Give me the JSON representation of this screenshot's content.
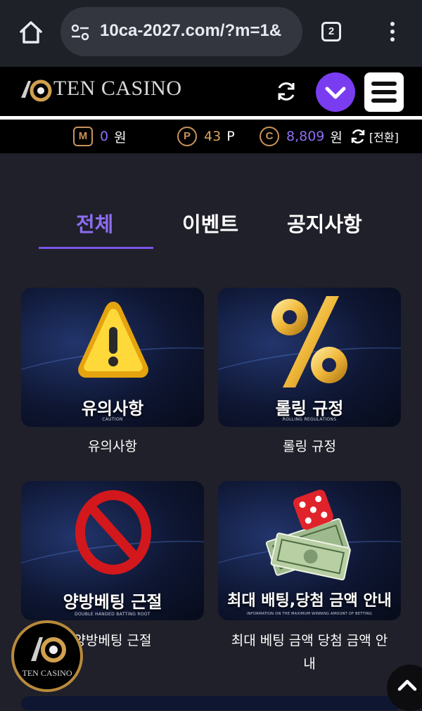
{
  "browser": {
    "url": "10ca-2027.com/?m=1&",
    "tab_count": "2"
  },
  "header": {
    "logo_text": "TEN CASINO"
  },
  "balance": {
    "money_badge": "M",
    "money_value": "0",
    "money_unit": "원",
    "point_badge": "P",
    "point_value": "43",
    "point_unit": "P",
    "coin_badge": "C",
    "coin_value": "8,809",
    "coin_unit": "원",
    "exchange_label": "[전환]"
  },
  "tabs": [
    {
      "label": "전체",
      "active": true
    },
    {
      "label": "이벤트",
      "active": false
    },
    {
      "label": "공지사항",
      "active": false
    }
  ],
  "cards": [
    {
      "title": "유의사항",
      "subtitle": "CAUTION",
      "caption": "유의사항",
      "icon": "warning-icon"
    },
    {
      "title": "롤링 규정",
      "subtitle": "ROLLING REGULATIONS",
      "caption": "롤링 규정",
      "icon": "percent-icon"
    },
    {
      "title": "양방베팅 근절",
      "subtitle": "DOUBLE HANDED BATTING ROOT",
      "caption": "양방베팅 근절",
      "icon": "prohibited-icon"
    },
    {
      "title": "최대 배팅,당첨 금액 안내",
      "subtitle": "INFORMATION ON THE MAXIMUM WINNING AMOUNT OF BETTING",
      "caption_line1": "최대 베팅 금액 당첨 금액 안",
      "caption_line2": "내",
      "icon": "dice-money-icon"
    }
  ],
  "floating": {
    "logo_text": "TEN CASINO"
  },
  "colors": {
    "accent": "#7a3cf0",
    "accent_text": "#8d6cf2",
    "gold": "#d6a25d"
  }
}
